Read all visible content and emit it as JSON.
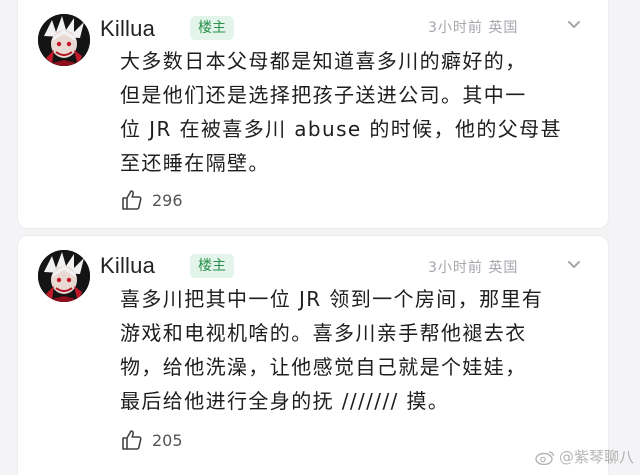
{
  "comments": [
    {
      "username": "Killua",
      "badge": "楼主",
      "meta": "3小时前 英国",
      "avatar_icon": "anime-avatar-icon",
      "text": "大多数日本父母都是知道喜多川的癖好的，\n但是他们还是选择把孩子送进公司。其中一\n位 JR 在被喜多川 abuse 的时候，他的父母甚\n至还睡在隔壁。",
      "likes": "296"
    },
    {
      "username": "Killua",
      "badge": "楼主",
      "meta": "3小时前 英国",
      "avatar_icon": "anime-avatar-icon",
      "text": "喜多川把其中一位 JR 领到一个房间，那里有\n游戏和电视机啥的。喜多川亲手帮他褪去衣\n物，给他洗澡，让他感觉自己就是个娃娃，\n最后给他进行全身的抚 /////// 摸。",
      "likes": "205"
    }
  ],
  "watermark": {
    "text": "@紫琴聊八",
    "icon": "weibo-logo-icon"
  },
  "colors": {
    "badge_text": "#2a8f4a",
    "badge_bg": "#e3f5ea",
    "meta": "#a6a6ad"
  }
}
